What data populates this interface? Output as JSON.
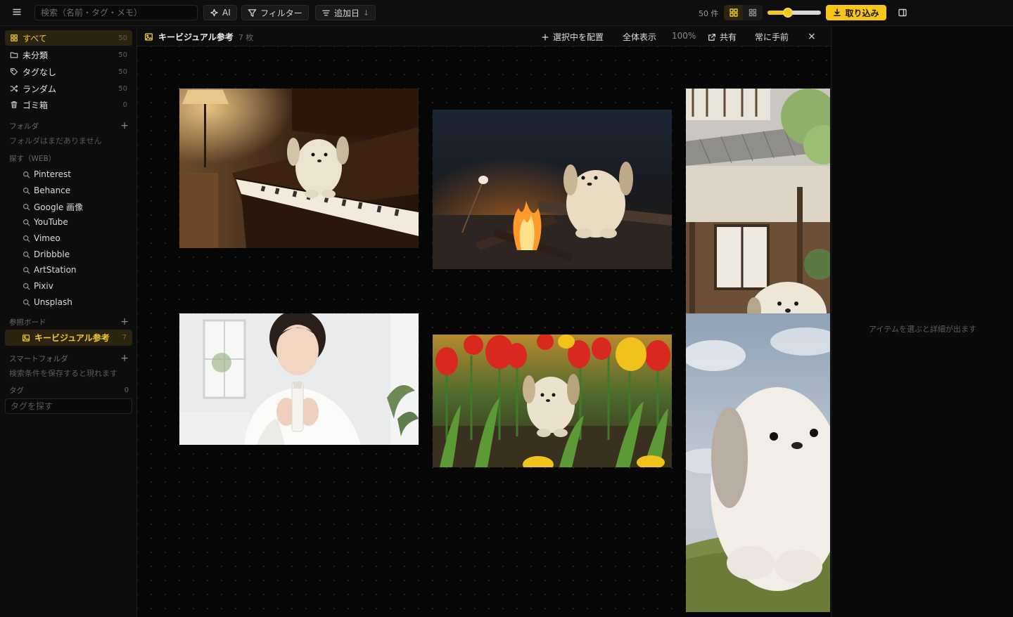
{
  "topbar": {
    "search_placeholder": "検索（名前・タグ・メモ）",
    "ai_label": "AI",
    "filter_label": "フィルター",
    "sort_label": "追加日",
    "sort_arrow": "↓",
    "item_count": "50 件",
    "zoom_fraction": 0.35,
    "import_label": "取り込み",
    "accent_color": "#f5c518"
  },
  "sidebar": {
    "nav": [
      {
        "label": "すべて",
        "count": "50",
        "icon": "grid-icon",
        "active": true
      },
      {
        "label": "未分類",
        "count": "50",
        "icon": "folder-icon"
      },
      {
        "label": "タグなし",
        "count": "50",
        "icon": "tag-icon"
      },
      {
        "label": "ランダム",
        "count": "50",
        "icon": "shuffle-icon"
      },
      {
        "label": "ゴミ箱",
        "count": "0",
        "icon": "trash-icon"
      }
    ],
    "folders_title": "フォルダ",
    "folders_empty": "フォルダはまだありません",
    "explore_title": "探す（WEB）",
    "web_sources": [
      "Pinterest",
      "Behance",
      "Google 画像",
      "YouTube",
      "Vimeo",
      "Dribbble",
      "ArtStation",
      "Pixiv",
      "Unsplash"
    ],
    "boards_title": "参照ボード",
    "board_item": {
      "label": "キービジュアル参考",
      "count": "7"
    },
    "smart_title": "スマートフォルダ",
    "smart_hint": "検索条件を保存すると現れます",
    "tags_title": "タグ",
    "tags_count": "0",
    "tag_search_placeholder": "タグを探す"
  },
  "board": {
    "title": "キービジュアル参考",
    "count": "7 枚",
    "place_label": "選択中を配置",
    "fit_label": "全体表示",
    "zoom_label": "100%",
    "share_label": "共有",
    "pin_label": "常に手前",
    "close_glyph": "×"
  },
  "cards": [
    {
      "name": "plush-on-piano"
    },
    {
      "name": "plush-at-campfire"
    },
    {
      "name": "plush-at-japanese-house"
    },
    {
      "name": "woman-holding-bottle"
    },
    {
      "name": "plush-in-tulips"
    },
    {
      "name": "plush-on-grass-closeup"
    }
  ],
  "detail_panel": {
    "empty_hint": "アイテムを選ぶと詳細が出ます"
  }
}
